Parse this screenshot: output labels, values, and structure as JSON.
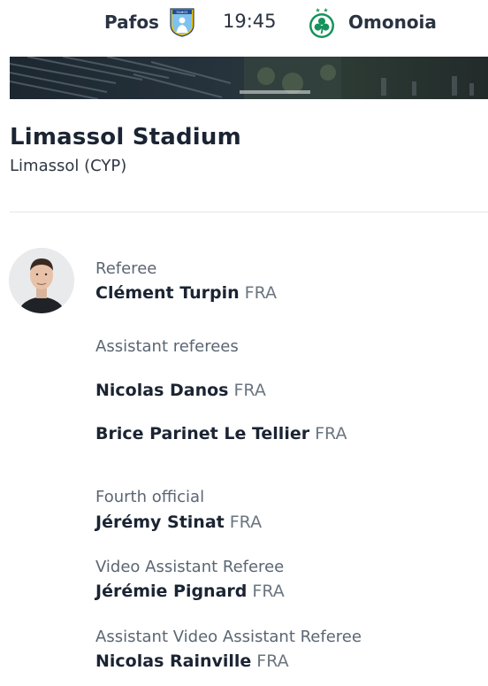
{
  "header": {
    "home_team": "Pafos",
    "away_team": "Omonoia",
    "kickoff_time": "19:45",
    "home_crest_text": "ΠΑΦΟΣ"
  },
  "venue": {
    "stadium_name": "Limassol Stadium",
    "location": "Limassol (CYP)"
  },
  "officials": {
    "referee": {
      "role": "Referee",
      "name": "Clément Turpin",
      "nationality": "FRA"
    },
    "assistant_referees": {
      "role": "Assistant referees",
      "people": [
        {
          "name": "Nicolas Danos",
          "nationality": "FRA"
        },
        {
          "name": "Brice Parinet Le Tellier",
          "nationality": "FRA"
        }
      ]
    },
    "fourth_official": {
      "role": "Fourth official",
      "name": "Jérémy Stinat",
      "nationality": "FRA"
    },
    "var": {
      "role": "Video Assistant Referee",
      "name": "Jérémie Pignard",
      "nationality": "FRA"
    },
    "avar": {
      "role": "Assistant Video Assistant Referee",
      "name": "Nicolas Rainville",
      "nationality": "FRA"
    }
  },
  "colors": {
    "text_dark": "#1b2433",
    "text_muted": "#5b6673",
    "divider": "#e3e6ea",
    "pafos_blue": "#3b8fd4",
    "pafos_yellow": "#f2c400",
    "omonoia_green": "#16935a"
  },
  "icons": {
    "home_crest": "pafos-crest-icon",
    "away_crest": "omonoia-crest-icon"
  }
}
